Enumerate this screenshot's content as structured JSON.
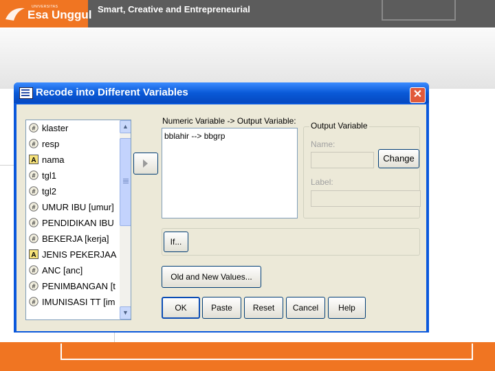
{
  "slide": {
    "logo_university": "UNIVERSITAS",
    "logo_text": "Esa Unggul",
    "tagline": "Smart, Creative and Entrepreneurial"
  },
  "dialog": {
    "title": "Recode into Different Variables",
    "close_symbol": "✕",
    "variables": [
      {
        "label": "klaster",
        "icon": "numeric-variable-icon"
      },
      {
        "label": "resp",
        "icon": "numeric-variable-icon"
      },
      {
        "label": "nama",
        "icon": "string-variable-icon"
      },
      {
        "label": "tgl1",
        "icon": "numeric-variable-icon"
      },
      {
        "label": "tgl2",
        "icon": "numeric-variable-icon"
      },
      {
        "label": "UMUR IBU [umur]",
        "icon": "numeric-variable-icon"
      },
      {
        "label": "PENDIDIKAN IBU",
        "icon": "numeric-variable-icon"
      },
      {
        "label": "BEKERJA [kerja]",
        "icon": "numeric-variable-icon"
      },
      {
        "label": "JENIS PEKERJAA",
        "icon": "string-variable-icon"
      },
      {
        "label": "ANC [anc]",
        "icon": "numeric-variable-icon"
      },
      {
        "label": "PENIMBANGAN [t",
        "icon": "numeric-variable-icon"
      },
      {
        "label": "IMUNISASI TT [im",
        "icon": "numeric-variable-icon"
      }
    ],
    "move_button_icon": "right-arrow-icon",
    "numeric_output_label": "Numeric Variable -> Output Variable:",
    "mapping": "bblahir --> bbgrp",
    "output_group": {
      "legend": "Output Variable",
      "name_label": "Name:",
      "name_value": "",
      "label_label": "Label:",
      "label_value": "",
      "change_button": "Change"
    },
    "if_button": "If...",
    "old_new_button": "Old and New Values...",
    "buttons": {
      "ok": "OK",
      "paste": "Paste",
      "reset": "Reset",
      "cancel": "Cancel",
      "help": "Help"
    }
  },
  "colors": {
    "brand_orange": "#f07522",
    "header_gray": "#5c5c5c",
    "titlebar_blue": "#0a58dc"
  }
}
